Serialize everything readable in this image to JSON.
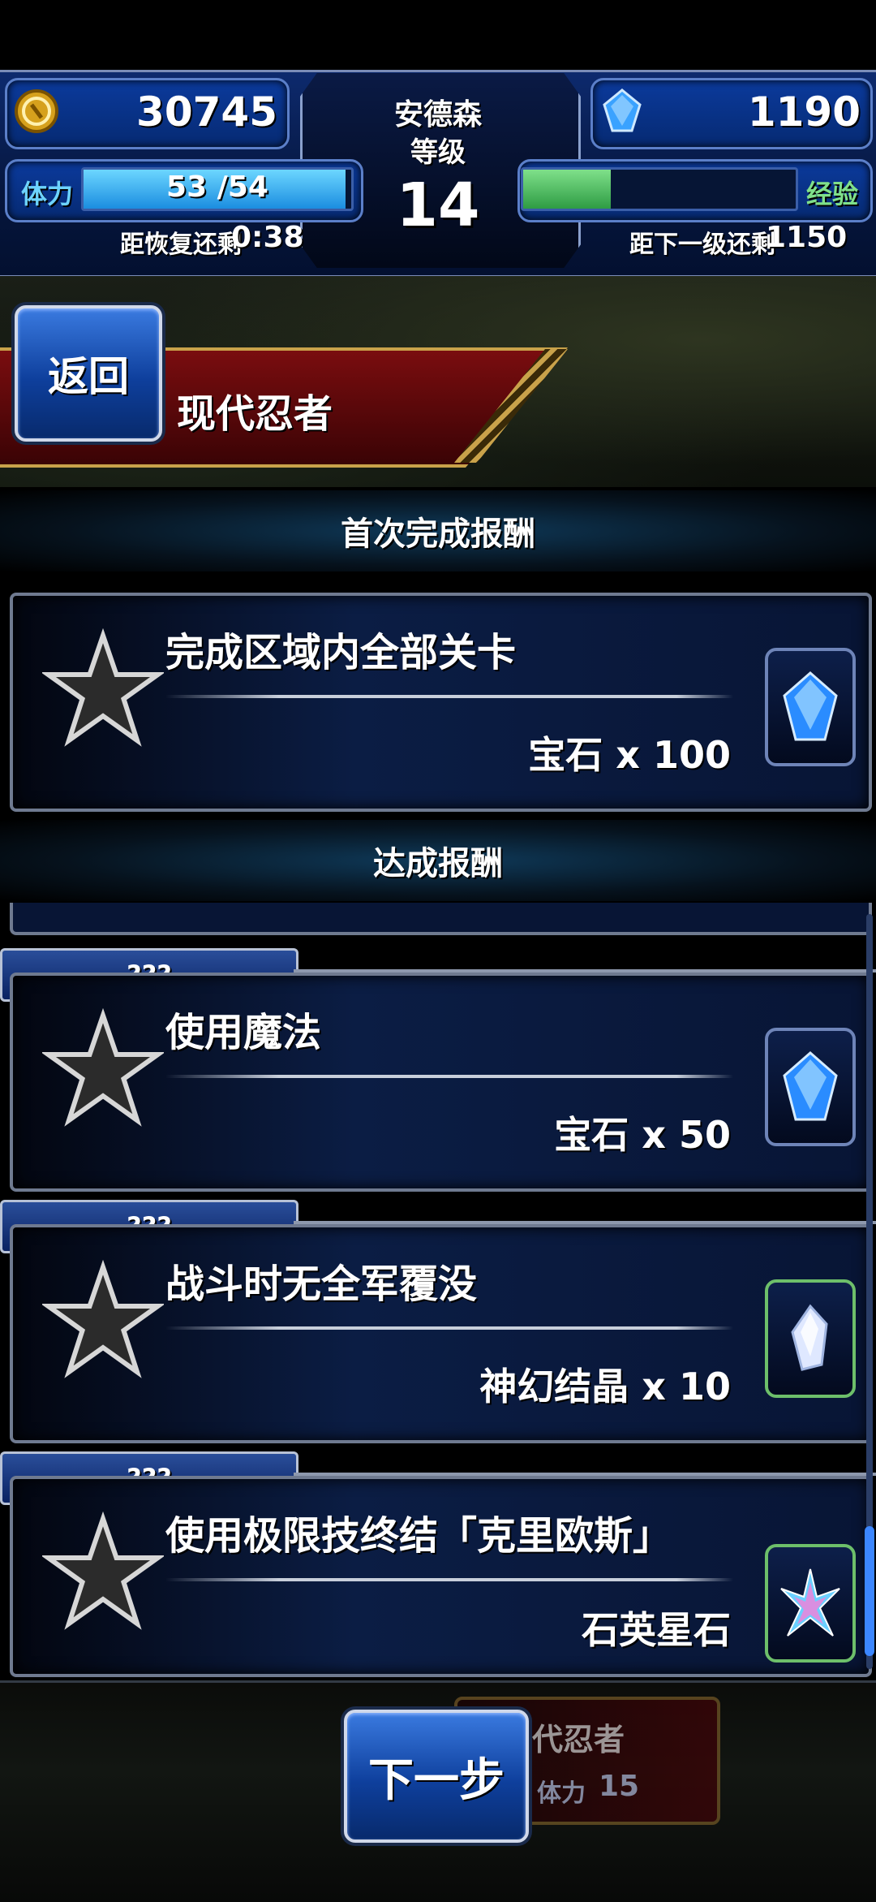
{
  "status": {
    "gil": "30745",
    "gems": "1190",
    "player_name": "安德森",
    "level_label": "等级",
    "level": "14",
    "stamina_label": "体力",
    "stamina_value": "53 /54",
    "stamina_fraction": 0.98,
    "recover_label": "距恢复还剩",
    "recover_time": "0:38",
    "exp_label": "经验",
    "exp_fraction": 0.32,
    "next_level_label": "距下一级还剩",
    "next_level_value": "1150"
  },
  "header": {
    "back_label": "返回",
    "stage_title": "现代忍者"
  },
  "sections": {
    "first_clear": "首次完成报酬",
    "achievement": "达成报酬"
  },
  "first_clear_mission": {
    "title": "完成区域内全部关卡",
    "reward": "宝石 x 100",
    "icon": "gem-icon"
  },
  "missions": [
    {
      "tag": "???",
      "title": "使用魔法",
      "reward": "宝石 x 50",
      "icon": "gem-icon"
    },
    {
      "tag": "???",
      "title": "战斗时无全军覆没",
      "reward": "神幻结晶 x 10",
      "icon": "crystal-icon"
    },
    {
      "tag": "???",
      "title": "使用极限技终结「克里欧斯」",
      "reward": "石英星石",
      "icon": "star-quartz-icon"
    }
  ],
  "footer": {
    "next_label": "下一步",
    "ghost_title": "代忍者",
    "ghost_stamina_label": "体力",
    "ghost_stamina_value": "15"
  },
  "colors": {
    "accent_blue": "#0e3f9c",
    "title_red": "#7a0d0f",
    "gold_trim": "#c9a24a",
    "stamina_bar": "#1b8de0",
    "exp_bar": "#2e9c44"
  }
}
